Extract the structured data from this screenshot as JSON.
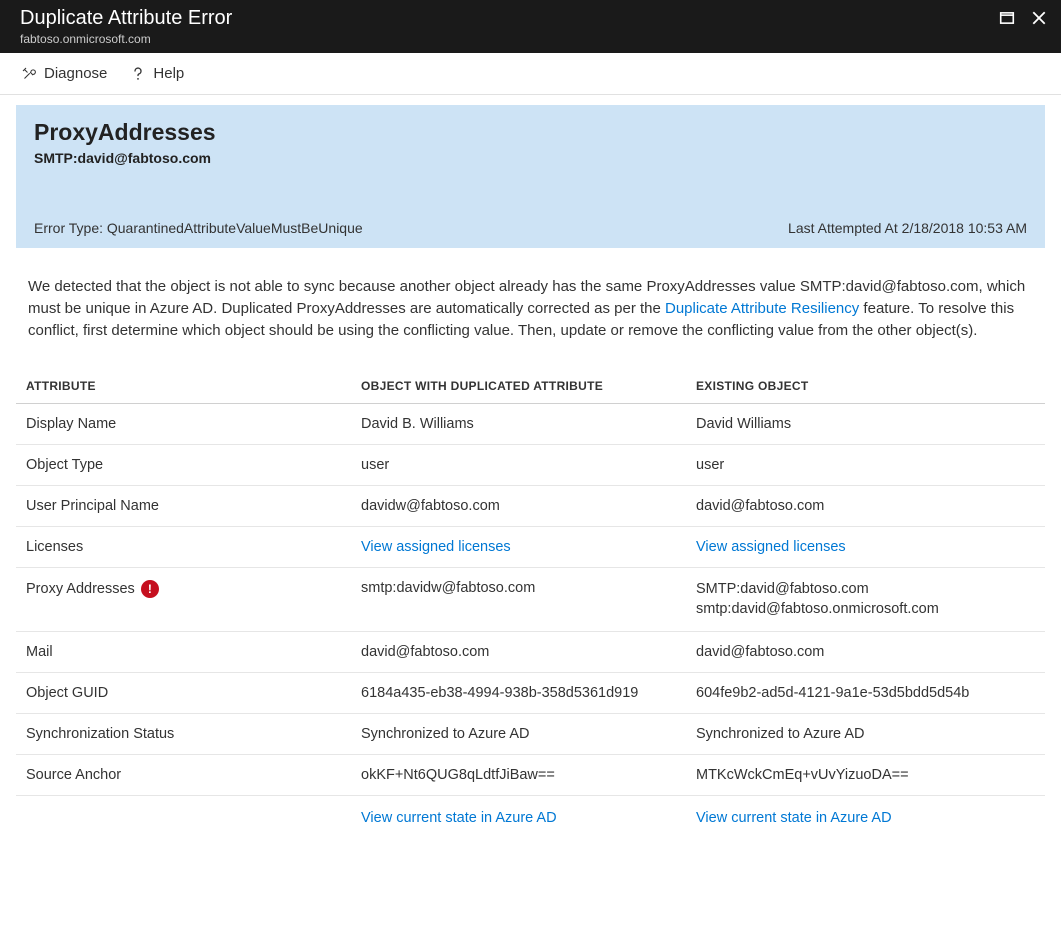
{
  "titlebar": {
    "title": "Duplicate Attribute Error",
    "subtitle": "fabtoso.onmicrosoft.com"
  },
  "toolbar": {
    "diagnose": "Diagnose",
    "help": "Help"
  },
  "banner": {
    "title": "ProxyAddresses",
    "subtitle": "SMTP:david@fabtoso.com",
    "error_type_label": "Error Type: QuarantinedAttributeValueMustBeUnique",
    "last_attempt_label": "Last Attempted At 2/18/2018 10:53 AM"
  },
  "description": {
    "part1": "We detected that the object is not able to sync because another object already has the same ProxyAddresses value SMTP:david@fabtoso.com, which must be unique in Azure AD. Duplicated ProxyAddresses are automatically corrected as per the ",
    "link": "Duplicate Attribute Resiliency",
    "part2": " feature. To resolve this conflict, first determine which object should be using the conflicting value. Then, update or remove the conflicting value from the other object(s)."
  },
  "table": {
    "headers": {
      "attribute": "ATTRIBUTE",
      "duplicated": "OBJECT WITH DUPLICATED ATTRIBUTE",
      "existing": "EXISTING OBJECT"
    },
    "rows": [
      {
        "attr": "Display Name",
        "dup": "David B. Williams",
        "exist": "David Williams"
      },
      {
        "attr": "Object Type",
        "dup": "user",
        "exist": "user"
      },
      {
        "attr": "User Principal Name",
        "dup": "davidw@fabtoso.com",
        "exist": "david@fabtoso.com"
      },
      {
        "attr": "Licenses",
        "dup_link": "View assigned licenses",
        "exist_link": "View assigned licenses"
      },
      {
        "attr": "Proxy Addresses",
        "error": true,
        "dup": "smtp:davidw@fabtoso.com",
        "exist_lines": [
          "SMTP:david@fabtoso.com",
          "smtp:david@fabtoso.onmicrosoft.com"
        ]
      },
      {
        "attr": "Mail",
        "dup": "david@fabtoso.com",
        "exist": "david@fabtoso.com"
      },
      {
        "attr": "Object GUID",
        "dup": "6184a435-eb38-4994-938b-358d5361d919",
        "exist": "604fe9b2-ad5d-4121-9a1e-53d5bdd5d54b"
      },
      {
        "attr": "Synchronization Status",
        "dup": "Synchronized to Azure AD",
        "exist": "Synchronized to Azure AD"
      },
      {
        "attr": "Source Anchor",
        "dup": "okKF+Nt6QUG8qLdtfJiBaw==",
        "exist": "MTKcWckCmEq+vUvYizuoDA=="
      }
    ],
    "footer": {
      "dup_link": "View current state in Azure AD",
      "exist_link": "View current state in Azure AD"
    },
    "error_badge": "!"
  }
}
